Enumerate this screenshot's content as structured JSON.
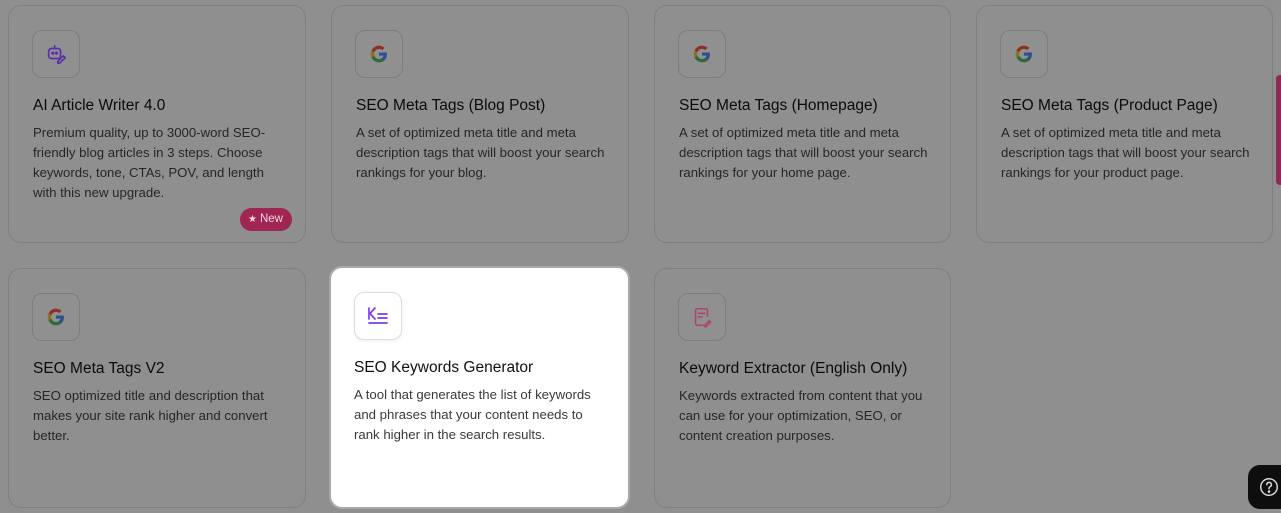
{
  "cards": [
    {
      "title": "AI Article Writer 4.0",
      "description": "Premium quality, up to 3000-word SEO-friendly blog articles in 3 steps. Choose keywords, tone, CTAs, POV, and length with this new upgrade.",
      "icon": "robot-pencil-icon",
      "badge": "New"
    },
    {
      "title": "SEO Meta Tags (Blog Post)",
      "description": "A set of optimized meta title and meta description tags that will boost your search rankings for your blog.",
      "icon": "google-icon"
    },
    {
      "title": "SEO Meta Tags (Homepage)",
      "description": "A set of optimized meta title and meta description tags that will boost your search rankings for your home page.",
      "icon": "google-icon"
    },
    {
      "title": "SEO Meta Tags (Product Page)",
      "description": "A set of optimized meta title and meta description tags that will boost your search rankings for your product page.",
      "icon": "google-icon"
    },
    {
      "title": "SEO Meta Tags V2",
      "description": "SEO optimized title and description that makes your site rank higher and convert better.",
      "icon": "google-icon"
    },
    {
      "title": "SEO Keywords Generator",
      "description": "A tool that generates the list of keywords and phrases that your content needs to rank higher in the search results.",
      "icon": "keyword-list-icon",
      "highlighted": true
    },
    {
      "title": "Keyword Extractor (English Only)",
      "description": "Keywords extracted from content that you can use for your optimization, SEO, or content creation purposes.",
      "icon": "document-pen-icon"
    }
  ],
  "colors": {
    "overlay": "#8f8f8f",
    "badge": "#9f2553",
    "accent_purple": "#7b3fe4",
    "accent_pink": "#d9468f"
  },
  "help": {
    "icon": "question-circle-icon"
  }
}
